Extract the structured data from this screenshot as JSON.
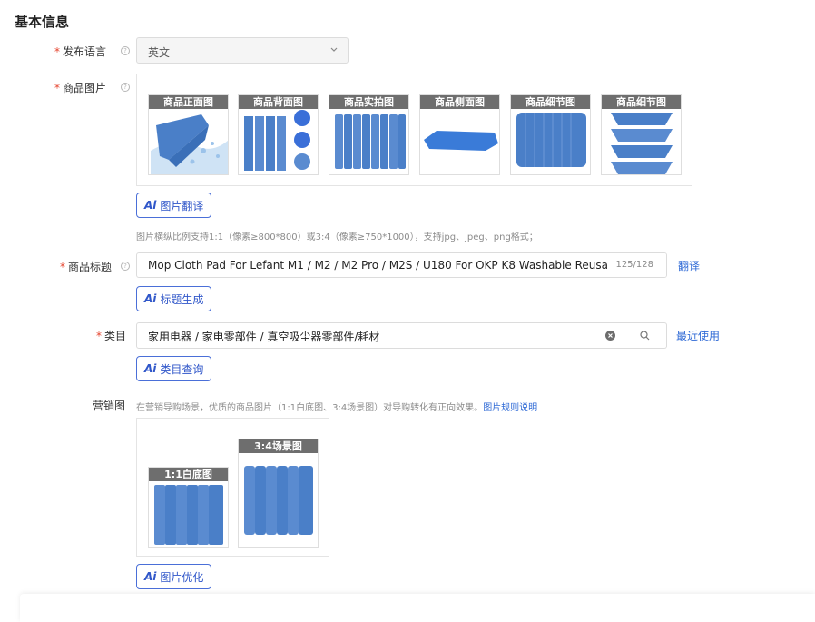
{
  "section": {
    "title": "基本信息"
  },
  "language": {
    "label": "发布语言",
    "value": "英文"
  },
  "images": {
    "label": "商品图片",
    "thumbs": [
      {
        "caption": "商品正面图",
        "icon": "mop-splash-image"
      },
      {
        "caption": "商品背面图",
        "icon": "mop-stack-image"
      },
      {
        "caption": "商品实拍图",
        "icon": "mop-row-image"
      },
      {
        "caption": "商品侧面图",
        "icon": "mop-side-image"
      },
      {
        "caption": "商品细节图",
        "icon": "mop-fan-image"
      },
      {
        "caption": "商品细节图",
        "icon": "mop-tiers-image"
      }
    ],
    "translate_button": "图片翻译",
    "hint": "图片横纵比例支持1:1（像素≥800*800）或3:4（像素≥750*1000），支持jpg、jpeg、png格式；"
  },
  "title_field": {
    "label": "商品标题",
    "value": "Mop Cloth Pad For Lefant M1 / M2 / M2 Pro / M2S / U180 For OKP K8 Washable Reusable Cleaning Mop Pads",
    "count": "125/128",
    "translate_link": "翻译",
    "generate_button": "标题生成"
  },
  "category": {
    "label": "类目",
    "value": "家用电器 / 家电零部件 / 真空吸尘器零部件/耗材",
    "recent_link": "最近使用",
    "query_button": "类目查询"
  },
  "marketing": {
    "label": "营销图",
    "hint": "在营销导购场景，优质的商品图片（1:1白底图、3:4场景图）对导购转化有正向效果。",
    "rule_link": "图片规则说明",
    "thumbs": [
      {
        "caption": "1:1白底图"
      },
      {
        "caption": "3:4场景图"
      }
    ],
    "optimize_button": "图片优化"
  },
  "ai_mark": "Ai",
  "help_mark": "?",
  "colors": {
    "accent": "#2f56c9",
    "link": "#2f6ad6",
    "required": "#e5432d",
    "mop": "#4a7fc8"
  }
}
